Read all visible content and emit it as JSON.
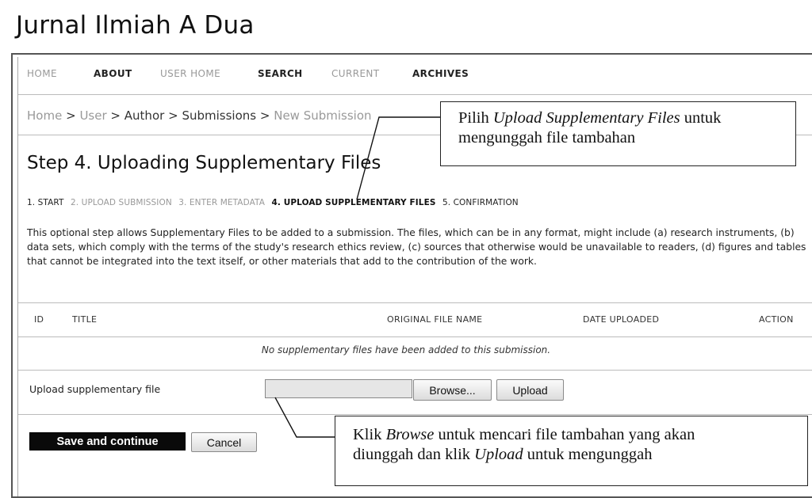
{
  "site": {
    "title": "Jurnal Ilmiah A Dua"
  },
  "nav": {
    "items": [
      {
        "label": "HOME",
        "style": "muted"
      },
      {
        "label": "ABOUT",
        "style": "dark"
      },
      {
        "label": "USER HOME",
        "style": "muted"
      },
      {
        "label": "SEARCH",
        "style": "dark"
      },
      {
        "label": "CURRENT",
        "style": "muted"
      },
      {
        "label": "ARCHIVES",
        "style": "dark"
      }
    ]
  },
  "breadcrumb": {
    "home": "Home",
    "sep": ">",
    "user": "User",
    "author": "Author",
    "submissions": "Submissions",
    "current": "New Submission"
  },
  "page": {
    "title": "Step 4. Uploading Supplementary Files"
  },
  "steps": {
    "s1": "1. START",
    "s2": "2. UPLOAD SUBMISSION",
    "s3": "3. ENTER METADATA",
    "s4": "4. UPLOAD SUPPLEMENTARY FILES",
    "s5": "5. CONFIRMATION"
  },
  "description": "This optional step allows Supplementary Files to be added to a submission. The files, which can be in any format, might include (a) research instruments, (b) data sets, which comply with the terms of the study's research ethics review, (c) sources that otherwise would be unavailable to readers, (d) figures and tables that cannot be integrated into the text itself, or other materials that add to the contribution of the work.",
  "table": {
    "columns": {
      "id": "ID",
      "title": "TITLE",
      "original": "ORIGINAL FILE NAME",
      "date": "DATE UPLOADED",
      "action": "ACTION"
    },
    "empty_message": "No supplementary files have been added to this submission."
  },
  "upload": {
    "label": "Upload supplementary file",
    "file_value": "",
    "browse_label": "Browse...",
    "upload_label": "Upload"
  },
  "actions": {
    "save_label": "Save and continue",
    "cancel_label": "Cancel"
  },
  "callouts": {
    "c1": {
      "pre": "Pilih ",
      "em": "Upload Supplementary Files",
      "post": " untuk",
      "line2": "mengunggah file tambahan"
    },
    "c2": {
      "pre": "Klik ",
      "em": "Browse",
      "post": "  untuk mencari file tambahan yang akan",
      "line2_pre": "diunggah dan klik ",
      "line2_em": "Upload",
      "line2_post": " untuk mengunggah"
    }
  }
}
